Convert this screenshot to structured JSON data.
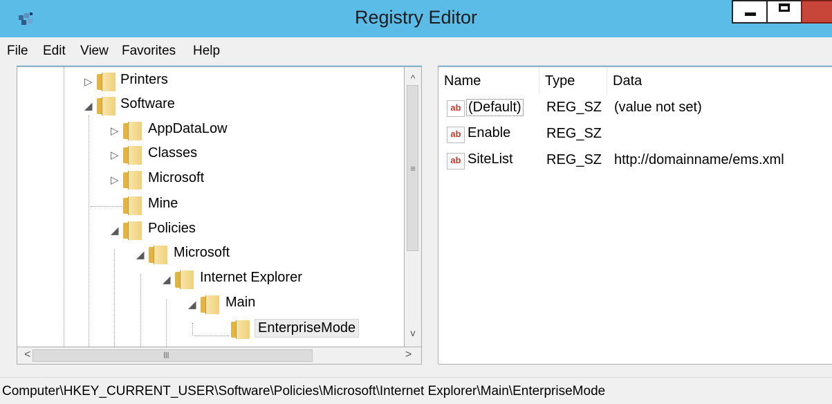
{
  "window": {
    "title": "Registry Editor",
    "icon": "registry-editor-icon"
  },
  "menu": {
    "items": [
      "File",
      "Edit",
      "View",
      "Favorites",
      "Help"
    ]
  },
  "tree": {
    "nodes": [
      {
        "label": "Printers",
        "expander": "▷"
      },
      {
        "label": "Software",
        "expander": "◢"
      },
      {
        "label": "AppDataLow",
        "expander": "▷"
      },
      {
        "label": "Classes",
        "expander": "▷"
      },
      {
        "label": "Microsoft",
        "expander": "▷"
      },
      {
        "label": "Mine",
        "expander": ""
      },
      {
        "label": "Policies",
        "expander": "◢"
      },
      {
        "label": "Microsoft",
        "expander": "◢"
      },
      {
        "label": "Internet Explorer",
        "expander": "◢"
      },
      {
        "label": "Main",
        "expander": "◢"
      },
      {
        "label": "EnterpriseMode",
        "expander": ""
      }
    ],
    "selected": "EnterpriseMode"
  },
  "values": {
    "columns": [
      "Name",
      "Type",
      "Data"
    ],
    "rows": [
      {
        "icon": "ab",
        "name": "(Default)",
        "type": "REG_SZ",
        "data": "(value not set)"
      },
      {
        "icon": "ab",
        "name": "Enable",
        "type": "REG_SZ",
        "data": ""
      },
      {
        "icon": "ab",
        "name": "SiteList",
        "type": "REG_SZ",
        "data": "http://domainname/ems.xml"
      }
    ]
  },
  "scrollbars": {
    "v_grip": "≡",
    "h_grip": "III",
    "up": "^",
    "down": "v",
    "left": "<",
    "right": ">"
  },
  "status": {
    "path": "Computer\\HKEY_CURRENT_USER\\Software\\Policies\\Microsoft\\Internet Explorer\\Main\\EnterpriseMode"
  },
  "colors": {
    "titlebar": "#5bbce8",
    "close_button": "#c8453a",
    "folder": "#e2b543"
  }
}
